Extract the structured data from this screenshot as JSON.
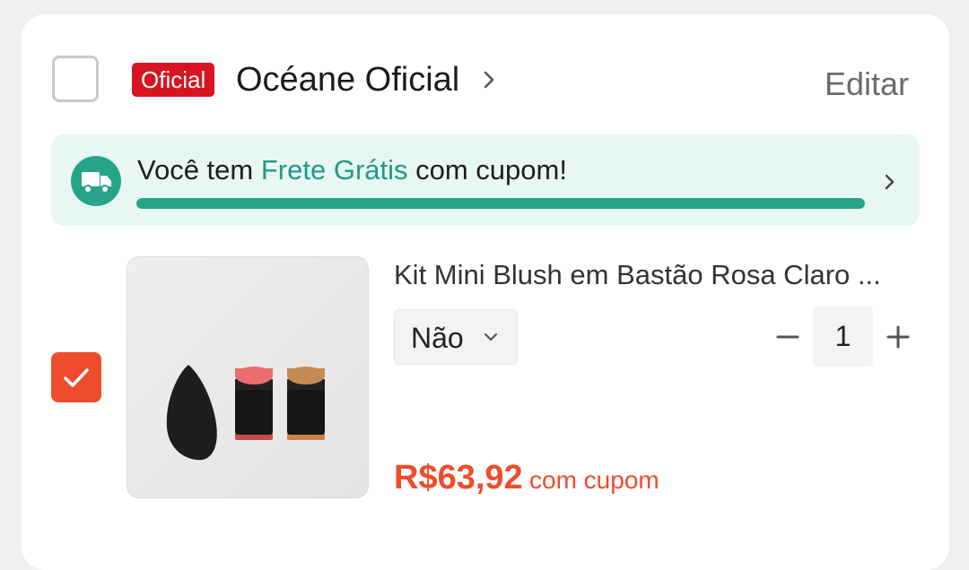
{
  "store": {
    "badge": "Oficial",
    "name": "Océane Oficial",
    "edit_label": "Editar",
    "selected": false
  },
  "shipping_banner": {
    "text_before": "Você tem ",
    "highlight": "Frete Grátis",
    "text_after": " com cupom!",
    "progress": 1.0,
    "icon": "truck-icon"
  },
  "item": {
    "selected": true,
    "title": "Kit Mini Blush em Bastão Rosa Claro ...",
    "variant": "Não",
    "quantity": "1",
    "price": "R$63,92",
    "price_note": "com cupom"
  },
  "colors": {
    "accent": "#ee4d2d",
    "badge_red": "#d8141e",
    "teal": "#26a48a",
    "banner_bg": "#e9f7f3"
  }
}
